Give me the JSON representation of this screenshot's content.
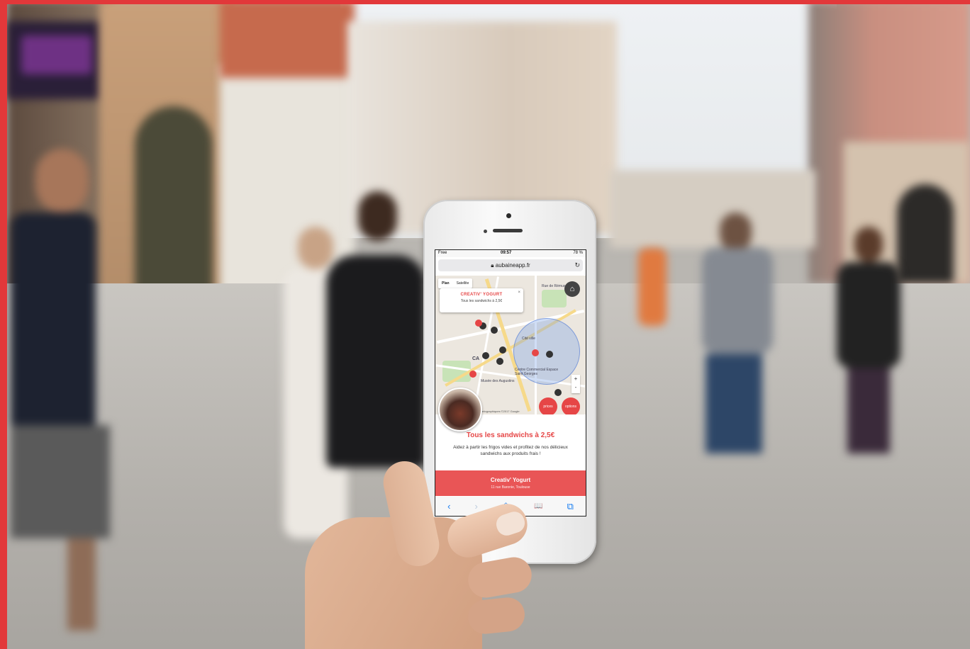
{
  "photo": {
    "subject": "hand holding smartphone on pedestrian street",
    "accent_color": "#e64646",
    "frame_color": "#e2383a"
  },
  "status_bar": {
    "carrier": "Free",
    "time": "09:57",
    "battery": "78 %"
  },
  "browser": {
    "url": "aubaineapp.fr",
    "lock_icon": "lock-icon",
    "reload_icon": "reload-icon"
  },
  "map": {
    "tab_plan": "Plan",
    "tab_satellite": "Satellite",
    "popup_title": "CREATIV' YOGURT",
    "popup_subtitle": "Tous les sandwichs à 2,5€",
    "popup_close": "×",
    "labels": [
      "Rue de Rémusat",
      "CA",
      "Centre Commercial Espace Saint Georges",
      "Musée des Augustins",
      "Cité ville"
    ],
    "credit": "Cartographiques ©2017 Google",
    "zoom_in": "+",
    "zoom_out": "-",
    "btn_left": "prices",
    "btn_right": "options"
  },
  "offer": {
    "title": "Tous les sandwichs à 2,5€",
    "description": "Aidez à partir les frigos vides et profitez de nos délicieux sandwichs aux produits frais !"
  },
  "shop": {
    "name": "Creativ' Yogurt",
    "address": "11 rue Baronie, Toulouse"
  },
  "toolbar": {
    "back": "‹",
    "forward": "›",
    "share": "⇪",
    "bookmarks": "📖",
    "tabs": "⧉"
  }
}
